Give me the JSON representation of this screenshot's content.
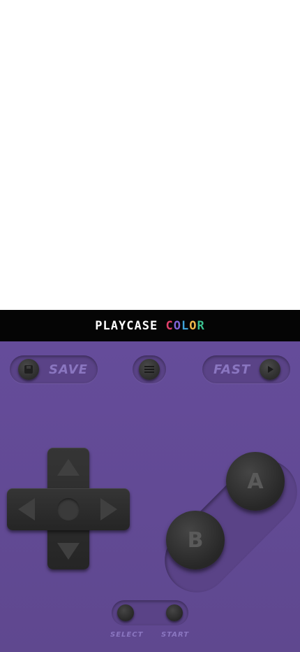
{
  "brand": {
    "name": "PLAYCASE",
    "color_word": [
      "C",
      "O",
      "L",
      "O",
      "R"
    ]
  },
  "controls": {
    "save_label": "SAVE",
    "fast_label": "FAST",
    "a_label": "A",
    "b_label": "B",
    "select_label": "SELECT",
    "start_label": "START"
  },
  "icons": {
    "save": "floppy-disk-icon",
    "menu": "hamburger-menu-icon",
    "fast": "play-triangle-icon"
  },
  "colors": {
    "shell": "#654c9a",
    "bar": "#050505",
    "label": "#8a76c0",
    "button": "#2c2c2c"
  }
}
